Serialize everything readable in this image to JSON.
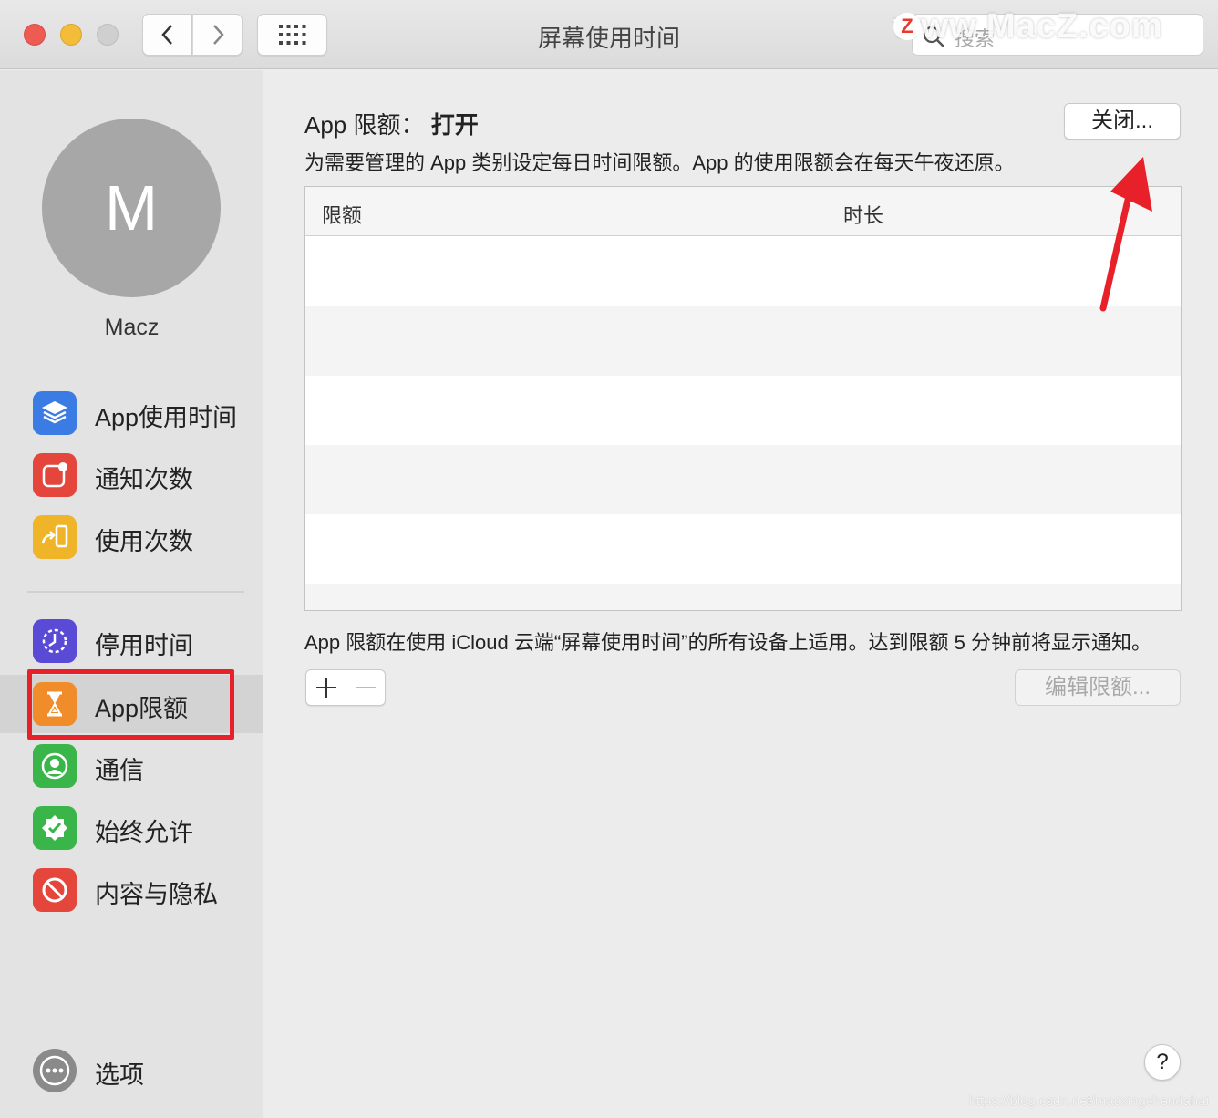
{
  "window": {
    "title": "屏幕使用时间",
    "search_placeholder": "搜索",
    "watermark_text": "www.MacZ.com",
    "watermark_badge": "Z"
  },
  "sidebar": {
    "avatar_initial": "M",
    "username": "Macz",
    "items": [
      {
        "label": "App使用时间",
        "icon": "layers-icon",
        "color": "#3b7be4"
      },
      {
        "label": "通知次数",
        "icon": "notification-icon",
        "color": "#e4463b"
      },
      {
        "label": "使用次数",
        "icon": "pickup-icon",
        "color": "#f0b429"
      },
      {
        "label": "停用时间",
        "icon": "downtime-icon",
        "color": "#5a4bd6"
      },
      {
        "label": "App限额",
        "icon": "hourglass-icon",
        "color": "#f08c2a",
        "selected": true
      },
      {
        "label": "通信",
        "icon": "contact-icon",
        "color": "#3ab54a"
      },
      {
        "label": "始终允许",
        "icon": "checkmark-badge-icon",
        "color": "#3ab54a"
      },
      {
        "label": "内容与隐私",
        "icon": "restricted-icon",
        "color": "#e4463b"
      }
    ],
    "options_label": "选项"
  },
  "main": {
    "status_label": "App 限额：",
    "status_value": "打开",
    "turn_off_button": "关闭...",
    "description": "为需要管理的 App 类别设定每日时间限额。App 的使用限额会在每天午夜还原。",
    "table": {
      "columns": [
        "限额",
        "时长"
      ],
      "rows": []
    },
    "note": "App 限额在使用 iCloud 云端“屏幕使用时间”的所有设备上适用。达到限额 5 分钟前将显示通知。",
    "edit_button": "编辑限额...",
    "help_button": "?"
  },
  "footer_url": "https://blog.csdn.net/macxingchendahai"
}
